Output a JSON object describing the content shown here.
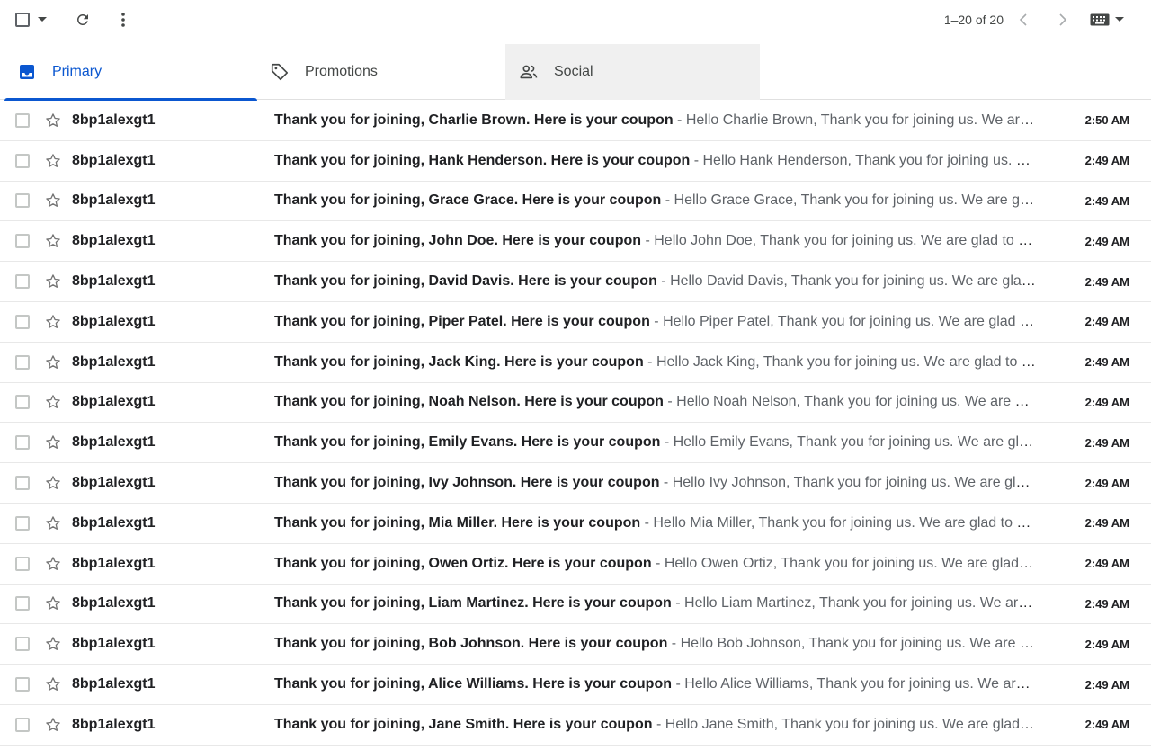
{
  "toolbar": {
    "page_count": "1–20 of 20"
  },
  "tabs": [
    {
      "label": "Primary",
      "icon": "inbox-icon"
    },
    {
      "label": "Promotions",
      "icon": "tag-icon"
    },
    {
      "label": "Social",
      "icon": "people-icon"
    }
  ],
  "colors": {
    "accent": "#0b57d0",
    "social_tab_bg": "#f0f0f0"
  },
  "emails": [
    {
      "sender": "8bp1alexgt1",
      "subject": "Thank you for joining, Charlie Brown. Here is your coupon",
      "snippet": "Hello Charlie Brown, Thank you for joining us. We are …",
      "time": "2:50 AM"
    },
    {
      "sender": "8bp1alexgt1",
      "subject": "Thank you for joining, Hank Henderson. Here is your coupon",
      "snippet": "Hello Hank Henderson, Thank you for joining us. W…",
      "time": "2:49 AM"
    },
    {
      "sender": "8bp1alexgt1",
      "subject": "Thank you for joining, Grace Grace. Here is your coupon",
      "snippet": "Hello Grace Grace, Thank you for joining us. We are gla…",
      "time": "2:49 AM"
    },
    {
      "sender": "8bp1alexgt1",
      "subject": "Thank you for joining, John Doe. Here is your coupon",
      "snippet": "Hello John Doe, Thank you for joining us. We are glad to w…",
      "time": "2:49 AM"
    },
    {
      "sender": "8bp1alexgt1",
      "subject": "Thank you for joining, David Davis. Here is your coupon",
      "snippet": "Hello David Davis, Thank you for joining us. We are glad …",
      "time": "2:49 AM"
    },
    {
      "sender": "8bp1alexgt1",
      "subject": "Thank you for joining, Piper Patel. Here is your coupon",
      "snippet": "Hello Piper Patel, Thank you for joining us. We are glad to …",
      "time": "2:49 AM"
    },
    {
      "sender": "8bp1alexgt1",
      "subject": "Thank you for joining, Jack King. Here is your coupon",
      "snippet": "Hello Jack King, Thank you for joining us. We are glad to w…",
      "time": "2:49 AM"
    },
    {
      "sender": "8bp1alexgt1",
      "subject": "Thank you for joining, Noah Nelson. Here is your coupon",
      "snippet": "Hello Noah Nelson, Thank you for joining us. We are gla…",
      "time": "2:49 AM"
    },
    {
      "sender": "8bp1alexgt1",
      "subject": "Thank you for joining, Emily Evans. Here is your coupon",
      "snippet": "Hello Emily Evans, Thank you for joining us. We are glad …",
      "time": "2:49 AM"
    },
    {
      "sender": "8bp1alexgt1",
      "subject": "Thank you for joining, Ivy Johnson. Here is your coupon",
      "snippet": "Hello Ivy Johnson, Thank you for joining us. We are glad…",
      "time": "2:49 AM"
    },
    {
      "sender": "8bp1alexgt1",
      "subject": "Thank you for joining, Mia Miller. Here is your coupon",
      "snippet": "Hello Mia Miller, Thank you for joining us. We are glad to w…",
      "time": "2:49 AM"
    },
    {
      "sender": "8bp1alexgt1",
      "subject": "Thank you for joining, Owen Ortiz. Here is your coupon",
      "snippet": "Hello Owen Ortiz, Thank you for joining us. We are glad t…",
      "time": "2:49 AM"
    },
    {
      "sender": "8bp1alexgt1",
      "subject": "Thank you for joining, Liam Martinez. Here is your coupon",
      "snippet": "Hello Liam Martinez, Thank you for joining us. We are …",
      "time": "2:49 AM"
    },
    {
      "sender": "8bp1alexgt1",
      "subject": "Thank you for joining, Bob Johnson. Here is your coupon",
      "snippet": "Hello Bob Johnson, Thank you for joining us. We are gl…",
      "time": "2:49 AM"
    },
    {
      "sender": "8bp1alexgt1",
      "subject": "Thank you for joining, Alice Williams. Here is your coupon",
      "snippet": "Hello Alice Williams, Thank you for joining us. We are g…",
      "time": "2:49 AM"
    },
    {
      "sender": "8bp1alexgt1",
      "subject": "Thank you for joining, Jane Smith. Here is your coupon",
      "snippet": "Hello Jane Smith, Thank you for joining us. We are glad t…",
      "time": "2:49 AM"
    }
  ]
}
